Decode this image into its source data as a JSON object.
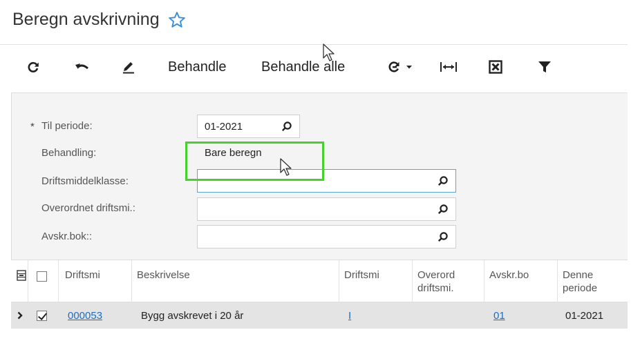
{
  "header": {
    "title": "Beregn avskrivning"
  },
  "toolbar": {
    "refresh_icon": "refresh-icon",
    "undo_icon": "undo-icon",
    "edit_icon": "pencil-icon",
    "process_label": "Behandle",
    "process_all_label": "Behandle alle",
    "schedule_icon": "schedule-refresh-icon",
    "fit_icon": "fit-width-icon",
    "excel_icon": "excel-export-icon",
    "filter_icon": "filter-icon"
  },
  "form": {
    "required_marker": "*",
    "period_label": "Til periode:",
    "period_value": "01-2021",
    "action_label": "Behandling:",
    "action_value": "Bare beregn",
    "class_label": "Driftsmiddelklasse:",
    "class_value": "",
    "parent_label": "Overordnet driftsmi.:",
    "parent_value": "",
    "book_label": "Avskr.bok::",
    "book_value": ""
  },
  "grid": {
    "columns": [
      "Driftsmi",
      "Beskrivelse",
      "Driftsmi",
      "Overord driftsmi.",
      "Avskr.bo",
      "Denne periode"
    ],
    "column_lines": [
      [
        "Driftsmi"
      ],
      [
        "Beskrivelse"
      ],
      [
        "Driftsmi"
      ],
      [
        "Overord",
        "driftsmi."
      ],
      [
        "Avskr.bo"
      ],
      [
        "Denne",
        "periode"
      ]
    ],
    "rows": [
      {
        "selected": true,
        "asset_id": "000053",
        "description": "Bygg avskrevet i 20 år",
        "asset_class": "I",
        "parent": "",
        "book": "01",
        "period": "01-2021"
      }
    ]
  },
  "colors": {
    "highlight": "#46d12c",
    "link": "#1a6fbf",
    "focus_border": "#5aa4dd",
    "star": "#3b8fd9"
  }
}
